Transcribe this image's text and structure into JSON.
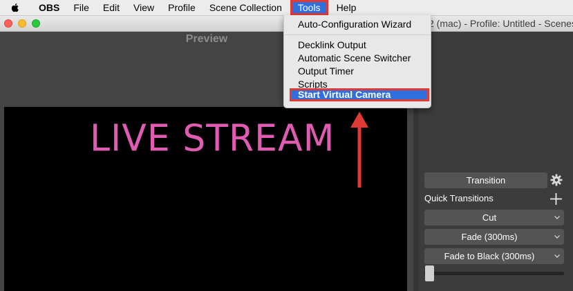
{
  "menubar": {
    "items": [
      "OBS",
      "File",
      "Edit",
      "View",
      "Profile",
      "Scene Collection",
      "Tools",
      "Help"
    ],
    "active_item": "Tools"
  },
  "window": {
    "title_fragment": "2 (mac) - Profile: Untitled - Scenes"
  },
  "preview": {
    "label": "Preview",
    "canvas_text": "LIVE STREAM"
  },
  "tools_menu": {
    "items": [
      {
        "label": "Auto-Configuration Wizard"
      },
      {
        "label": "Decklink Output"
      },
      {
        "label": "Automatic Scene Switcher"
      },
      {
        "label": "Output Timer"
      },
      {
        "label": "Scripts"
      },
      {
        "label": "Start Virtual Camera"
      }
    ],
    "highlighted": "Start Virtual Camera"
  },
  "transitions": {
    "transition_button": "Transition",
    "quick_transitions_label": "Quick Transitions",
    "options": [
      "Cut",
      "Fade (300ms)",
      "Fade to Black (300ms)"
    ],
    "slider_value": 0
  },
  "colors": {
    "highlight_blue": "#2f6fde",
    "annotation_red": "#e03a35",
    "canvas_text": "#e05cb3"
  },
  "icons": [
    "apple-icon",
    "gear-icon",
    "plus-icon",
    "chevron-down-icon"
  ]
}
